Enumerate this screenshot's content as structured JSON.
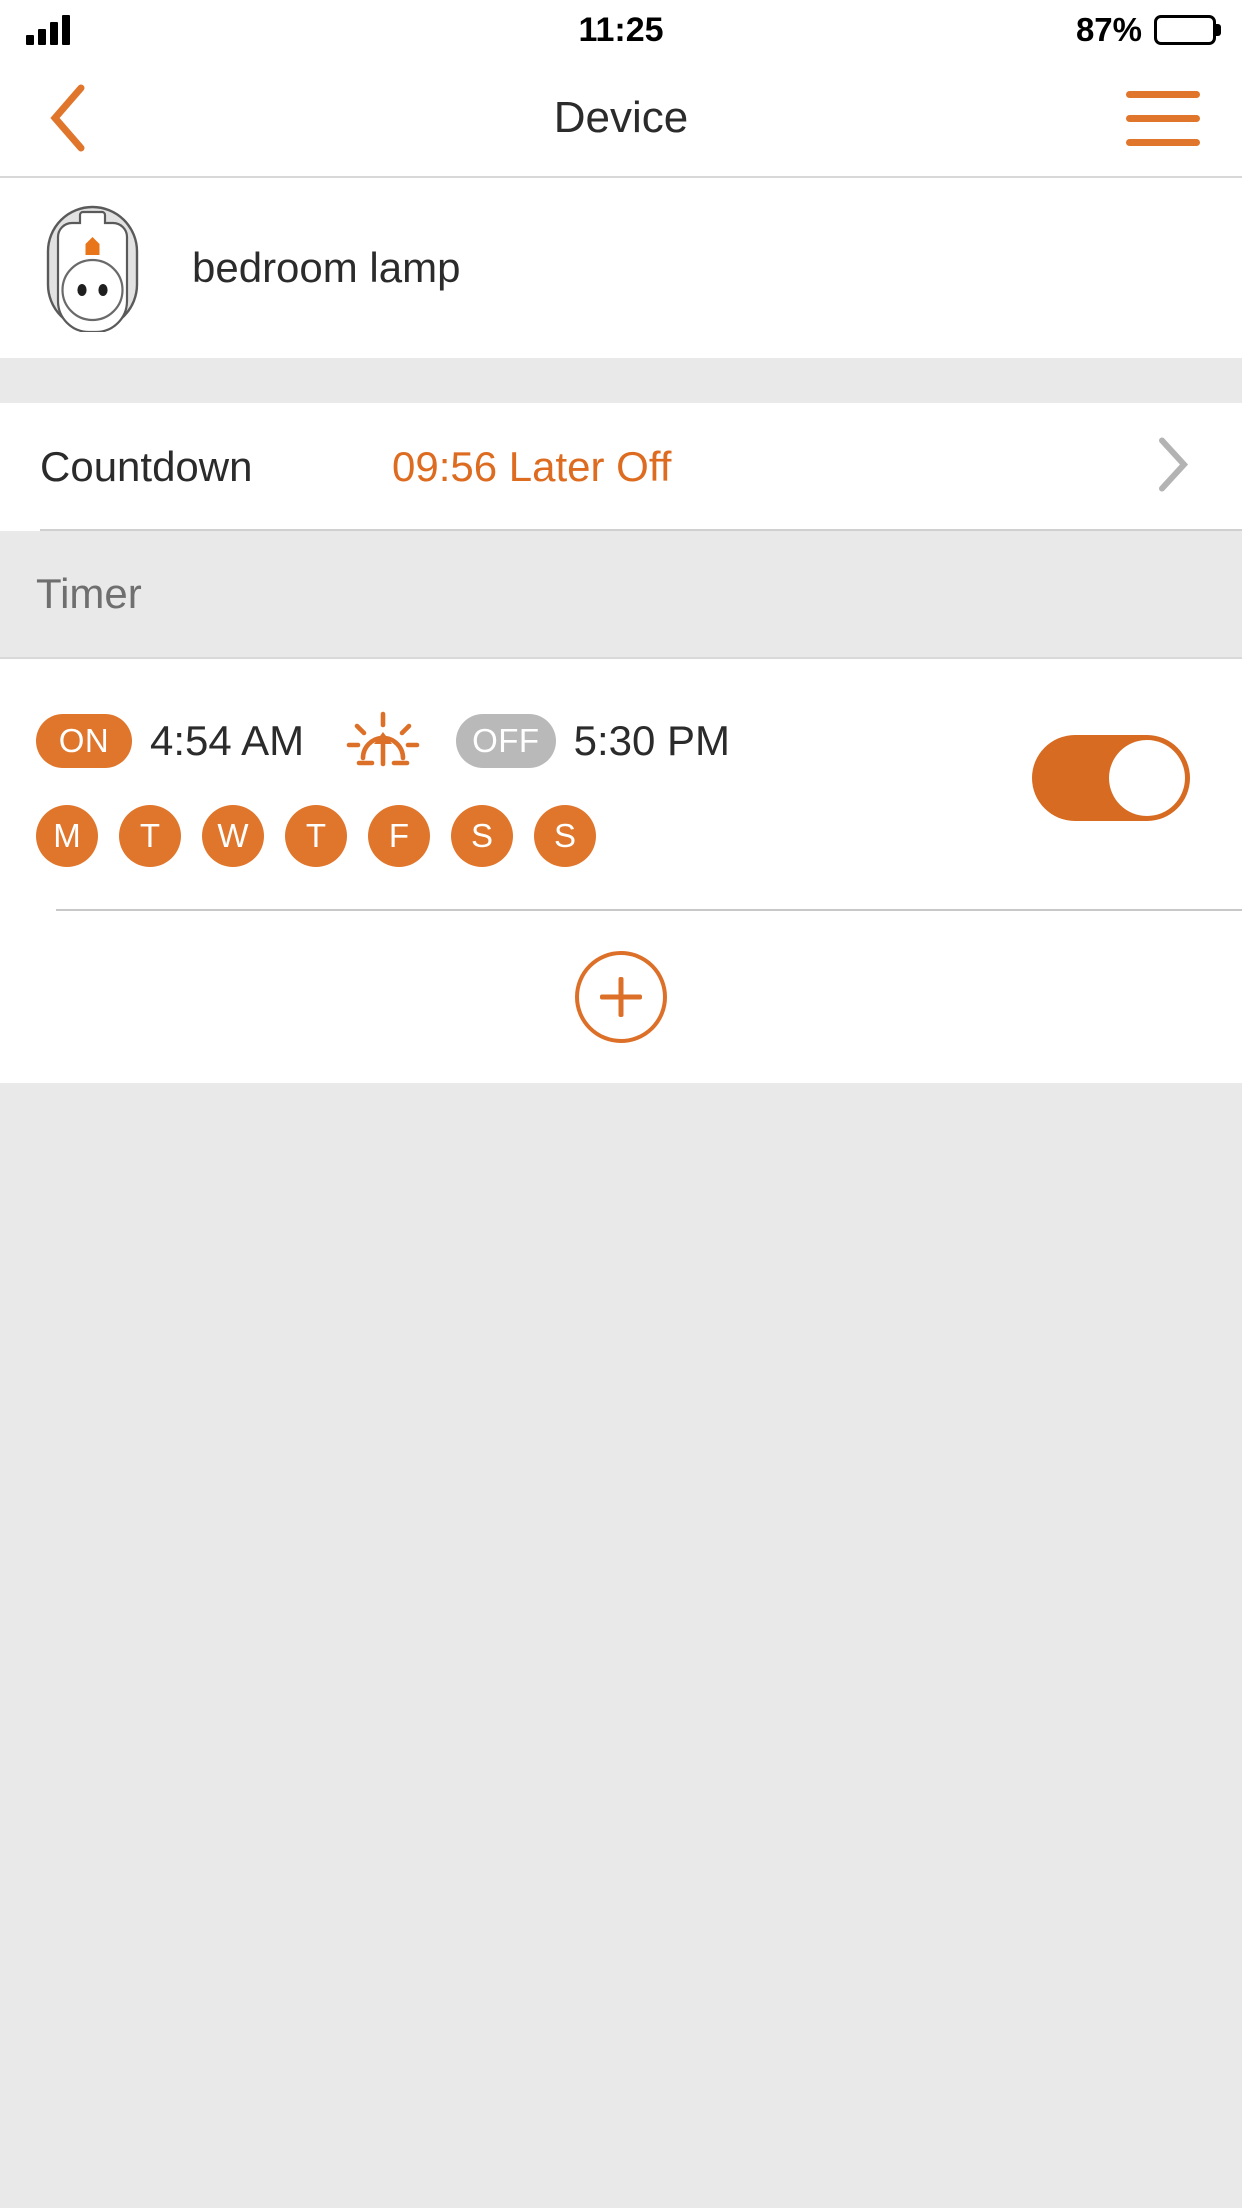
{
  "status_bar": {
    "signal_icon": "cellular-signal-icon",
    "time": "11:25",
    "battery_percent": "87%",
    "battery_icon": "battery-full-icon"
  },
  "nav_bar": {
    "back_icon": "chevron-left-icon",
    "title": "Device",
    "menu_icon": "hamburger-menu-icon"
  },
  "device": {
    "icon": "smart-plug-icon",
    "name": "bedroom lamp"
  },
  "countdown": {
    "label": "Countdown",
    "value": "09:56 Later Off",
    "chevron_icon": "chevron-right-icon"
  },
  "timer_section": {
    "header": "Timer",
    "entries": [
      {
        "on_badge": "ON",
        "on_time": "4:54 AM",
        "mode_icon": "sunrise-icon",
        "off_badge": "OFF",
        "off_time": "5:30 PM",
        "enabled": true,
        "days": [
          {
            "label": "M",
            "active": true
          },
          {
            "label": "T",
            "active": true
          },
          {
            "label": "W",
            "active": true
          },
          {
            "label": "T",
            "active": true
          },
          {
            "label": "F",
            "active": true
          },
          {
            "label": "S",
            "active": true
          },
          {
            "label": "S",
            "active": true
          }
        ]
      }
    ],
    "add_icon": "plus-circle-icon"
  },
  "colors": {
    "accent_orange": "#e0762c",
    "countdown_orange": "#dd6b20",
    "badge_off_gray": "#b9b9b9",
    "page_background": "#e9e9e9",
    "card_background": "#ffffff",
    "text_primary": "#2b2b2b",
    "text_muted": "#6f6f6f"
  }
}
